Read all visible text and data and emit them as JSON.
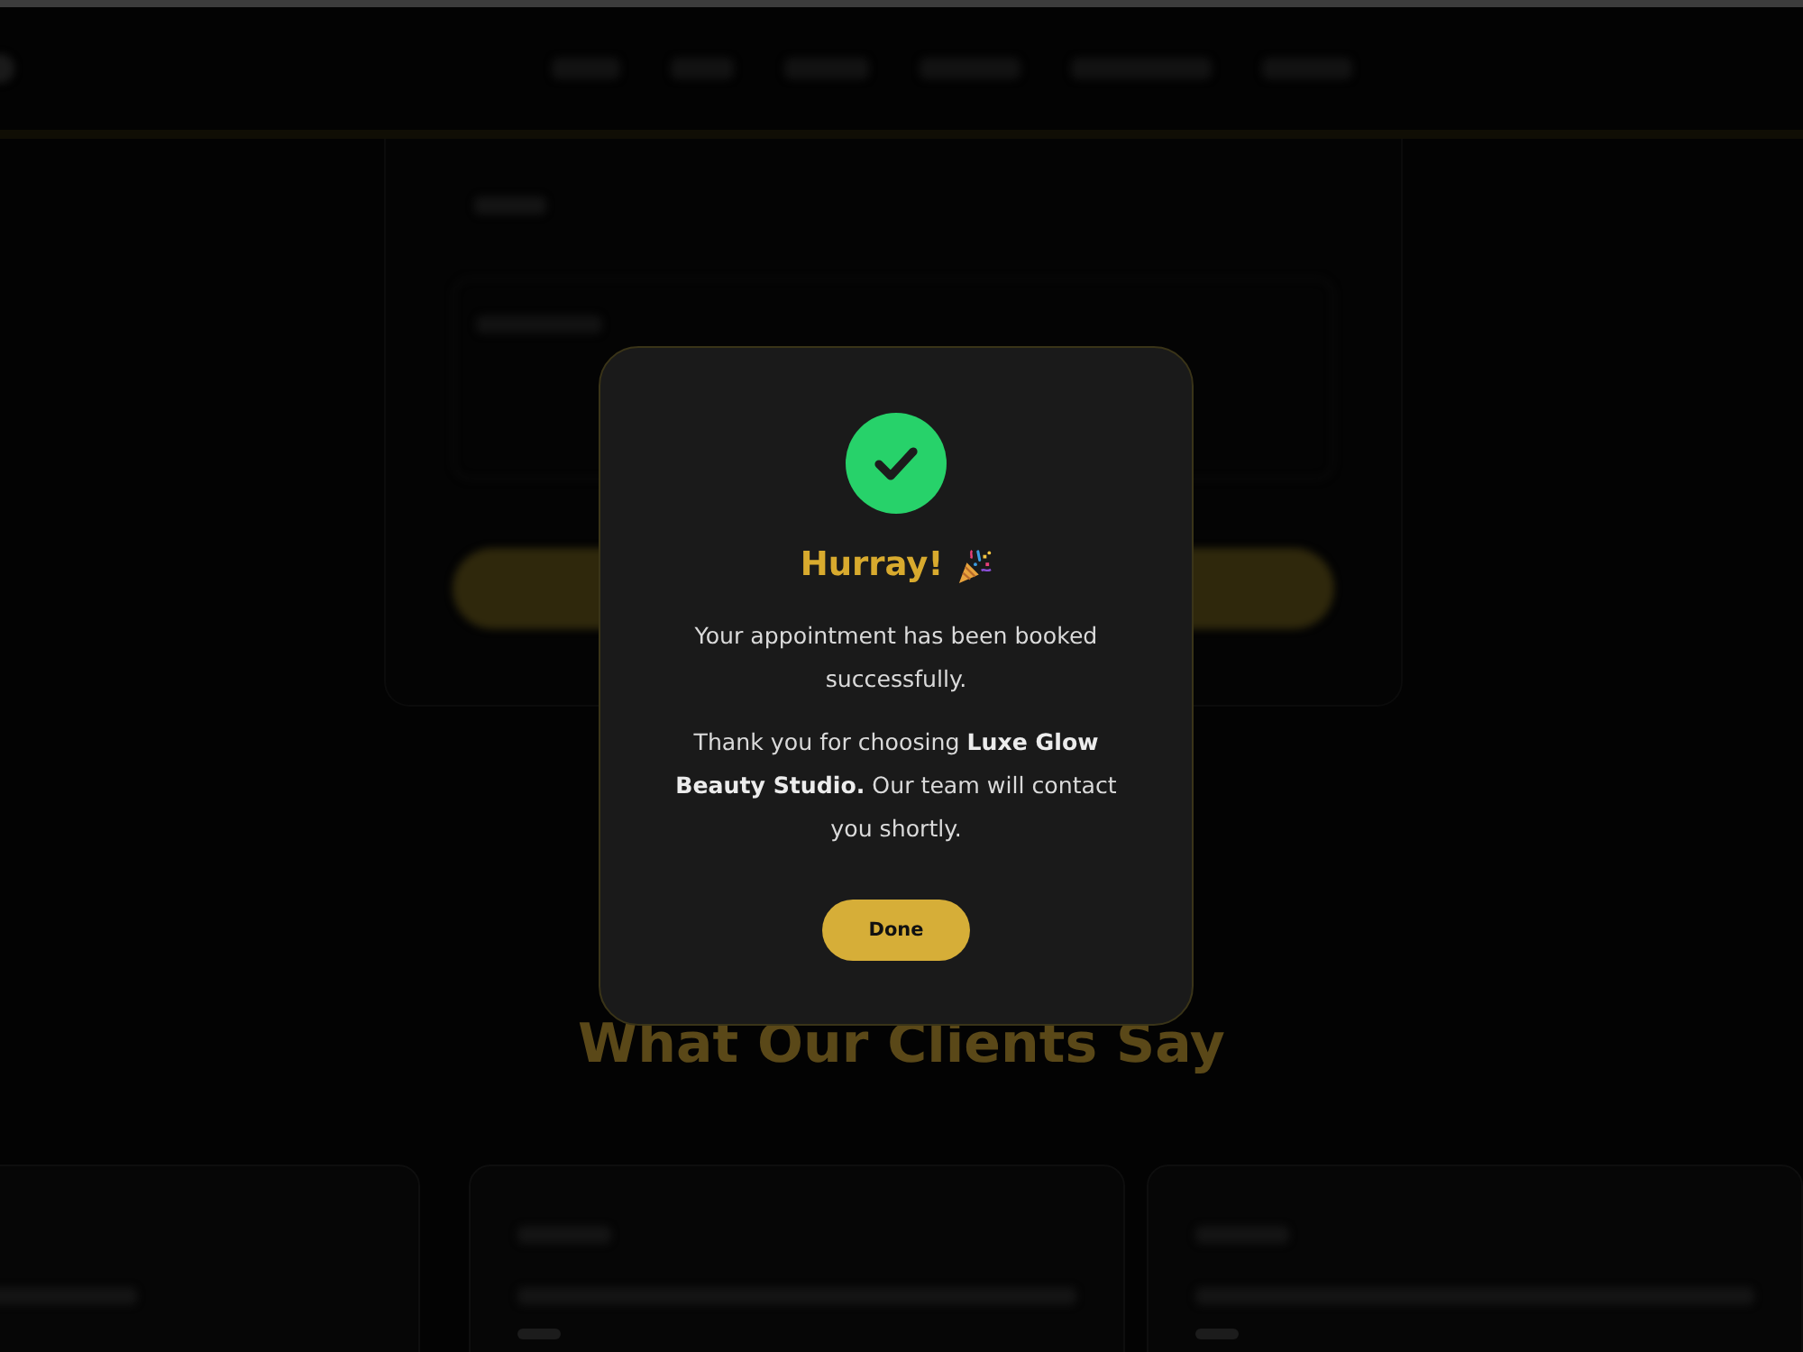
{
  "background": {
    "section_heading": "What Our Clients Say"
  },
  "dialog": {
    "title": "Hurray!",
    "paragraphs": [
      "Your appointment has been booked successfully.",
      "Thank you for choosing **Luxe Glow Beauty Studio.** Our team will contact you shortly."
    ],
    "button": "Done"
  }
}
